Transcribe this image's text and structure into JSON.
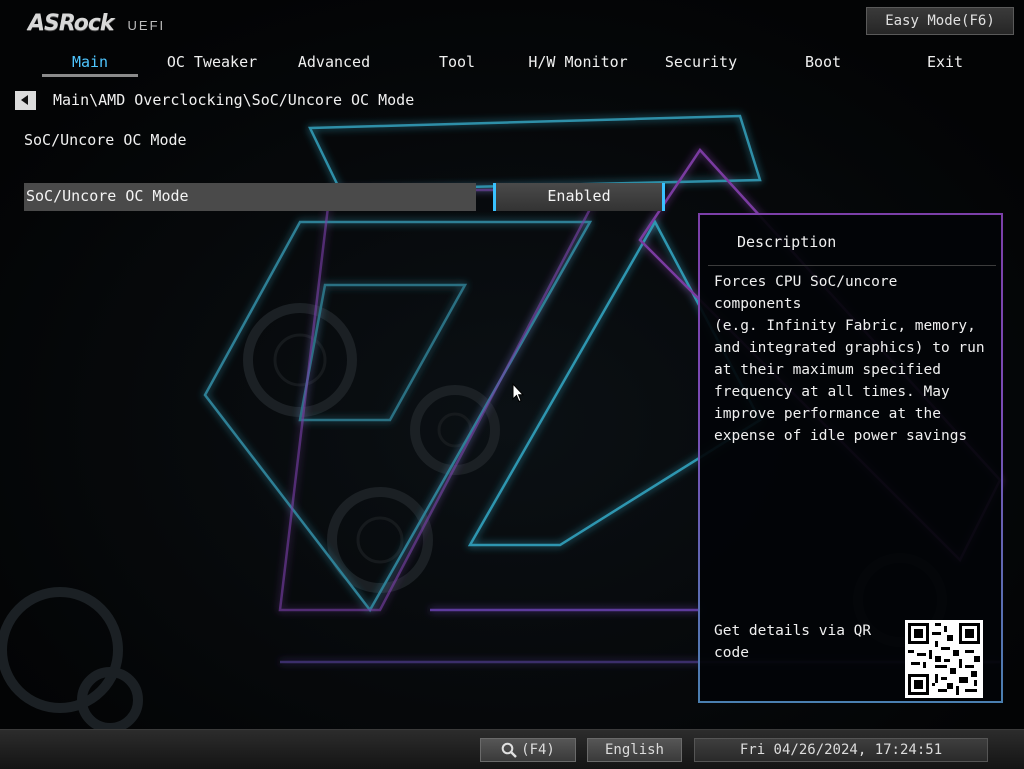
{
  "header": {
    "logo_main": "ASRock",
    "logo_sub": "UEFI",
    "easy_mode_label": "Easy Mode(F6)"
  },
  "tabs": [
    {
      "label": "Main",
      "active": true
    },
    {
      "label": "OC Tweaker"
    },
    {
      "label": "Advanced"
    },
    {
      "label": "Tool"
    },
    {
      "label": "H/W Monitor"
    },
    {
      "label": "Security"
    },
    {
      "label": "Boot"
    },
    {
      "label": "Exit"
    }
  ],
  "breadcrumb": "Main\\AMD Overclocking\\SoC/Uncore OC Mode",
  "page": {
    "section_title": "SoC/Uncore OC Mode",
    "setting": {
      "label": "SoC/Uncore OC Mode",
      "value": "Enabled"
    }
  },
  "description": {
    "title": "Description",
    "text": "Forces CPU SoC/uncore components\n(e.g. Infinity Fabric, memory,\nand integrated graphics) to run\nat their maximum specified\nfrequency at all times. May\nimprove performance at the\nexpense of idle power savings",
    "qr_text": "Get details via QR code"
  },
  "footer": {
    "search_key": "(F4)",
    "language": "English",
    "datetime": "Fri 04/26/2024, 17:24:51"
  },
  "icons": {
    "back": "chevron-left-icon",
    "search": "search-icon",
    "cursor": "mouse-pointer-icon"
  },
  "colors": {
    "accent": "#4fc6ff",
    "panel_border": "#7b3fa8",
    "background": "#050608"
  }
}
